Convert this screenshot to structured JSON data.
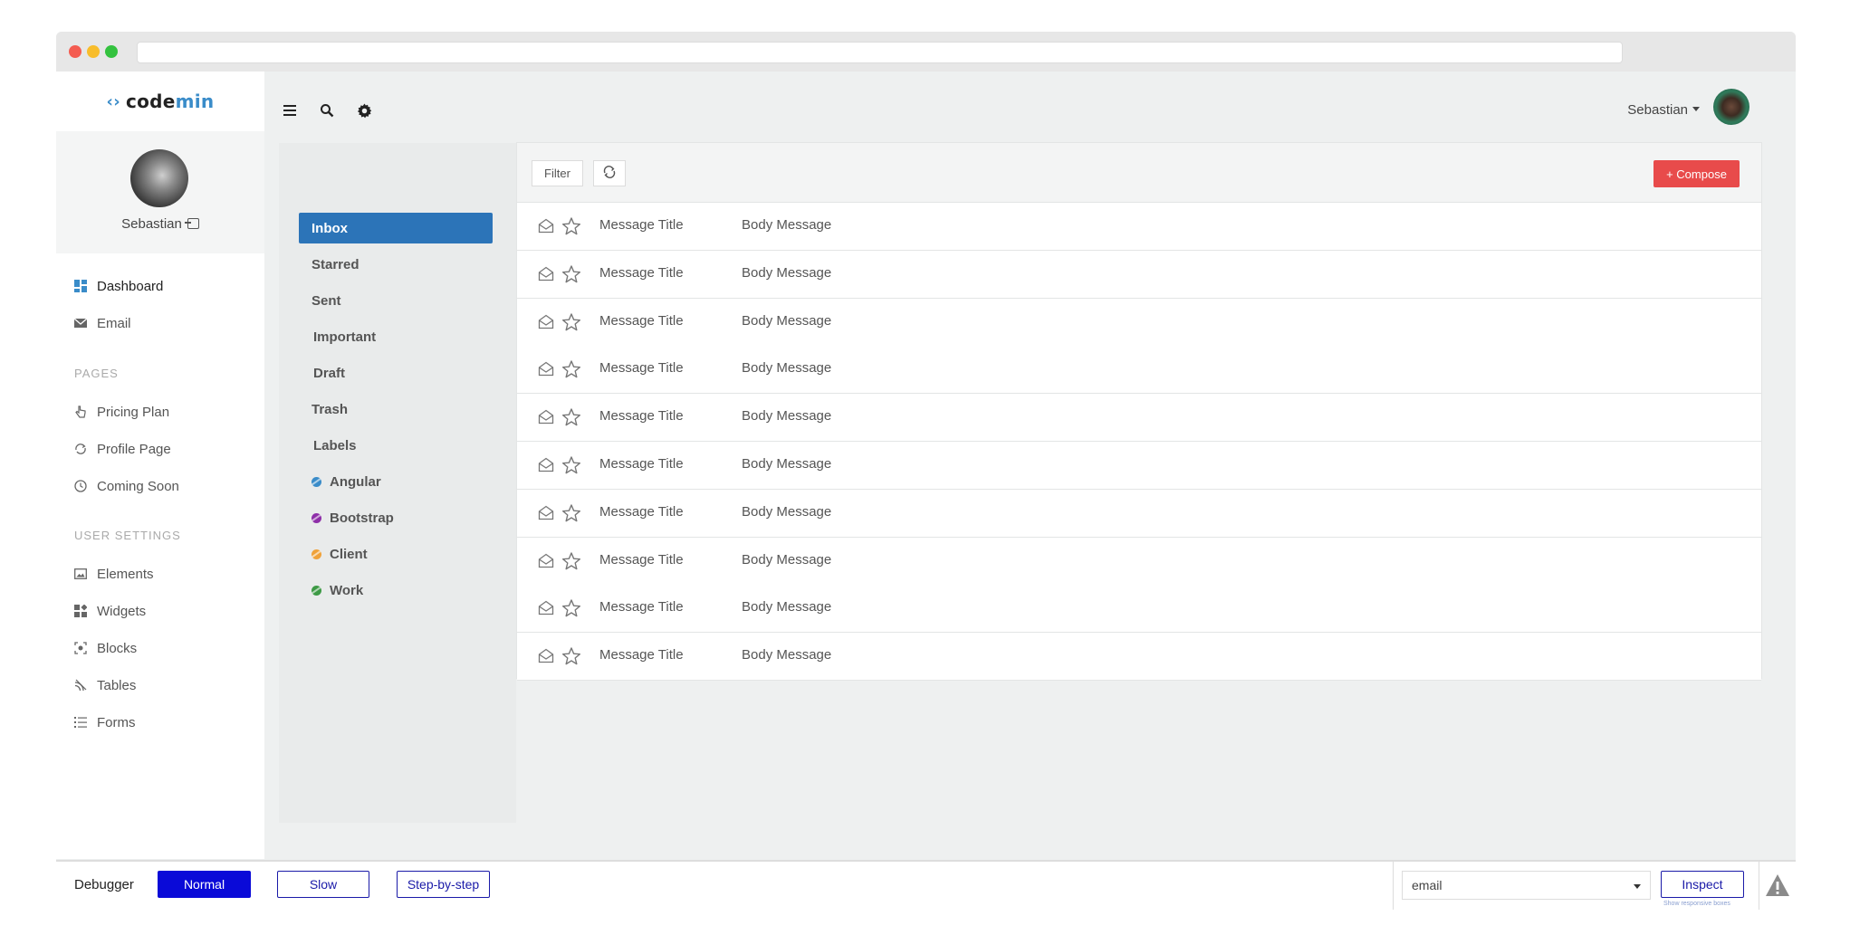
{
  "app": {
    "brand_prefix": "code",
    "brand_suffix": "min"
  },
  "profile": {
    "name": "Sebastian"
  },
  "sidebar": {
    "items": [
      {
        "label": "Dashboard",
        "icon": "dashboard-icon"
      },
      {
        "label": "Email",
        "icon": "envelope-icon"
      }
    ],
    "pages_heading": "PAGES",
    "pages": [
      {
        "label": "Pricing Plan",
        "icon": "pointer-icon"
      },
      {
        "label": "Profile Page",
        "icon": "sync-icon"
      },
      {
        "label": "Coming Soon",
        "icon": "clock-icon"
      }
    ],
    "settings_heading": "USER SETTINGS",
    "settings": [
      {
        "label": "Elements",
        "icon": "image-icon"
      },
      {
        "label": "Widgets",
        "icon": "widgets-icon"
      },
      {
        "label": "Blocks",
        "icon": "blocks-icon"
      },
      {
        "label": "Tables",
        "icon": "tables-icon"
      },
      {
        "label": "Forms",
        "icon": "list-icon"
      }
    ]
  },
  "header": {
    "user_name": "Sebastian"
  },
  "folders": {
    "items": [
      {
        "label": "Inbox"
      },
      {
        "label": "Starred"
      },
      {
        "label": "Sent"
      },
      {
        "label": "Important"
      },
      {
        "label": "Draft"
      },
      {
        "label": "Trash"
      },
      {
        "label": "Labels"
      }
    ],
    "labels": [
      {
        "label": "Angular",
        "color": "#3a8cc9"
      },
      {
        "label": "Bootstrap",
        "color": "#8e2fa8"
      },
      {
        "label": "Client",
        "color": "#f0a23a"
      },
      {
        "label": "Work",
        "color": "#3d9a45"
      }
    ]
  },
  "mailbox": {
    "filter_label": "Filter",
    "compose_label": "+ Compose",
    "messages": [
      {
        "title": "Message Title",
        "body": "Body Message"
      },
      {
        "title": "Message Title",
        "body": "Body Message"
      },
      {
        "title": "Message Title",
        "body": "Body Message"
      },
      {
        "title": "Message Title",
        "body": "Body Message"
      },
      {
        "title": "Message Title",
        "body": "Body Message"
      },
      {
        "title": "Message Title",
        "body": "Body Message"
      },
      {
        "title": "Message Title",
        "body": "Body Message"
      },
      {
        "title": "Message Title",
        "body": "Body Message"
      },
      {
        "title": "Message Title",
        "body": "Body Message"
      },
      {
        "title": "Message Title",
        "body": "Body Message"
      }
    ]
  },
  "debugger": {
    "label": "Debugger",
    "normal": "Normal",
    "slow": "Slow",
    "step": "Step-by-step",
    "select_value": "email",
    "inspect": "Inspect",
    "hint": "Show responsive boxes"
  },
  "colors": {
    "accent": "#2c74b8",
    "compose": "#e84b4b",
    "debugger_active": "#0a0ad8"
  }
}
